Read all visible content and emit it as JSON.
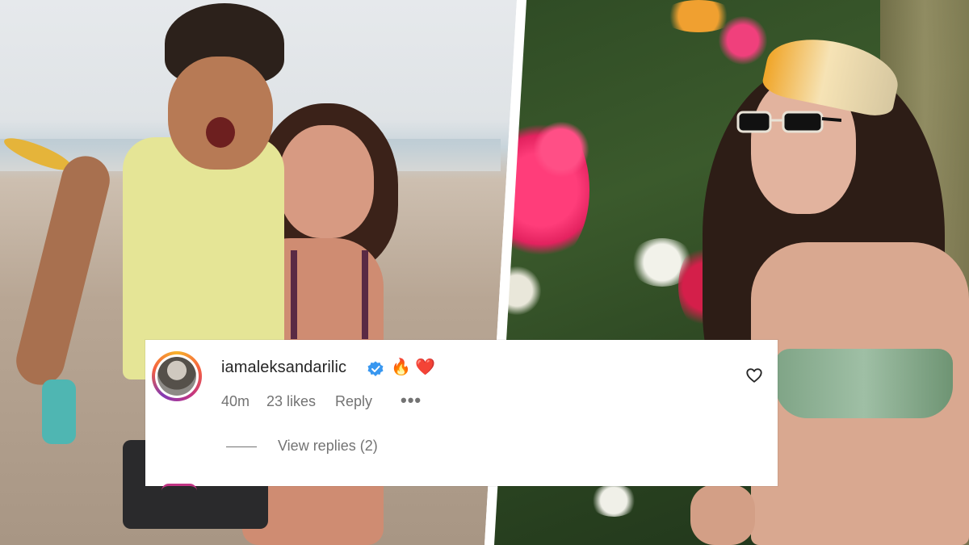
{
  "comment": {
    "username": "iamaleksandarilic",
    "verified": true,
    "emojis": [
      "🔥",
      "❤️"
    ],
    "time_ago": "40m",
    "likes": "23 likes",
    "reply_label": "Reply",
    "more_label": "•••",
    "view_replies_label": "View replies (2)"
  },
  "icons": {
    "verified_badge": "verified-badge-icon",
    "like": "heart-outline-icon",
    "more": "more-options-icon"
  },
  "colors": {
    "verified_blue": "#3897f0",
    "text_primary": "#262626",
    "text_secondary": "#737373",
    "story_ring": [
      "#f7b32b",
      "#f56040",
      "#c13584",
      "#833ab4"
    ]
  }
}
